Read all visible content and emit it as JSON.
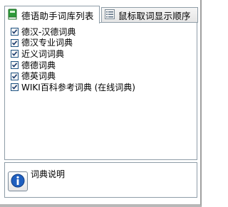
{
  "tabs": [
    {
      "label": "德语助手词库列表",
      "icon": "book-icon",
      "active": true
    },
    {
      "label": "鼠标取词显示顺序",
      "icon": "list-icon",
      "active": false
    }
  ],
  "dictionaries": [
    {
      "label": "德汉-汉德词典",
      "checked": true
    },
    {
      "label": "德汉专业词典",
      "checked": true
    },
    {
      "label": "近义词词典",
      "checked": true
    },
    {
      "label": "德德词典",
      "checked": true
    },
    {
      "label": "德英词典",
      "checked": true
    },
    {
      "label": "WIKI百科参考词典 (在线词典)",
      "checked": true
    }
  ],
  "info": {
    "label": "词典说明",
    "icon": "info-icon"
  },
  "colors": {
    "checkmark": "#1a3a6b",
    "tab_border": "#8f9da8",
    "info_blue": "#1f5fbf"
  }
}
